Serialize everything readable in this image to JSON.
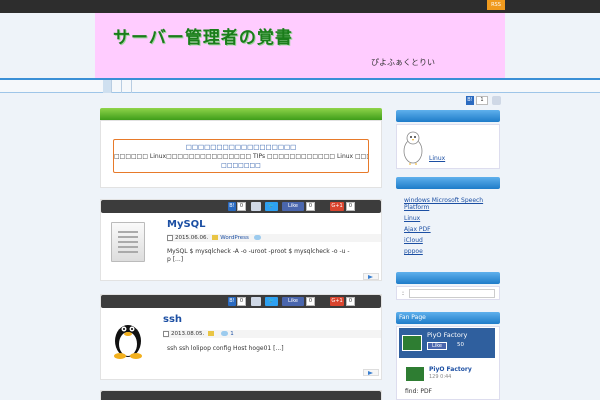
{
  "header": {
    "site_title": "サーバー管理者の覚書",
    "site_sub": "ぴよふぁくとりい"
  },
  "topbar": {
    "rss_label": "RSS"
  },
  "notice": {
    "title": "□□□□□□□□□□□□□□□□□□",
    "text": "□□□□□□ Linux□□□□□□□□□□□□□□□ TIPs □□□□□□□□□□□□ Linux □□□□□□□ Wo",
    "text2": "□□□□□□□"
  },
  "share": {
    "likes": "0",
    "hatena_b": "B!",
    "hatena_count": "0",
    "tweet": "🐦",
    "fb_like": "Like",
    "fb_count": "0",
    "gplus": "G+1",
    "gplus_count": "0"
  },
  "posts": [
    {
      "title": "MySQL",
      "date": "2015.06.06.",
      "category": "WordPress",
      "excerpt_line1": "MySQL   $ mysqlcheck -A -o -uroot -proot   $ mysqlcheck -o -u -",
      "excerpt_line2": "p         [...]",
      "comments": ""
    },
    {
      "title": "ssh",
      "date": "2013.08.05.",
      "category": "",
      "excerpt_line1": "ssh  ssh   lolipop config  Host hoge01 [...]",
      "excerpt_line2": "",
      "comments": "1"
    }
  ],
  "sidebar": {
    "hatena_count": "1",
    "profile_head": "",
    "profile_link": "Linux",
    "cat_head": "",
    "categories": [
      "windows Microsoft Speech Platform",
      "Linux",
      "Ajax  PDF",
      "iCloud",
      "pppoe"
    ],
    "search_label": ":",
    "fan_head": "Fan Page",
    "fan_name": "PiyO Factory",
    "fan_like_count": "50",
    "fan_sub": "PiyO Factory",
    "fan_sub_meta": "129  0:44",
    "fan_post": "find: PDF"
  },
  "colors": {
    "accent_blue": "#1e7cc8",
    "header_pink": "#ffccff",
    "title_green": "#1a7d1a"
  }
}
